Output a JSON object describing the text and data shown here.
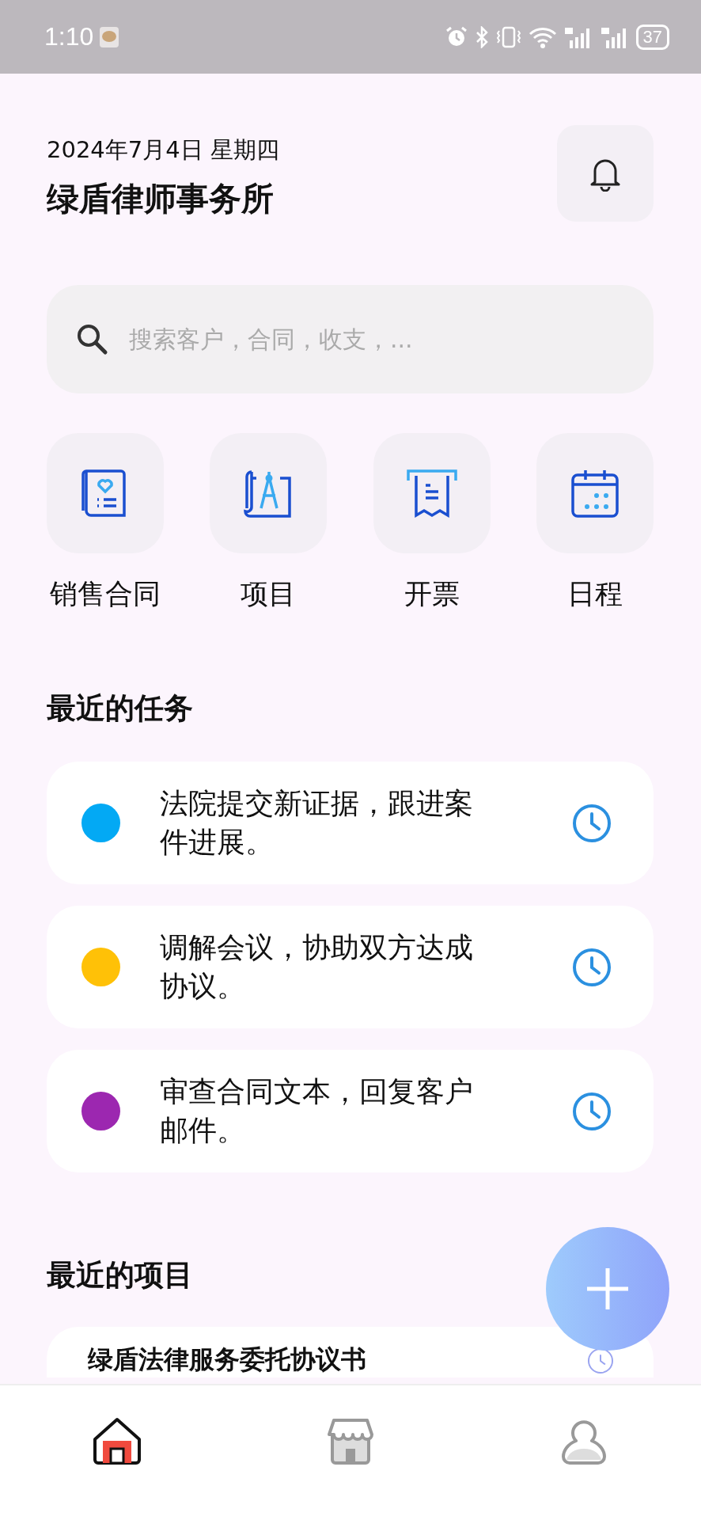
{
  "status_bar": {
    "time": "1:10",
    "battery": "37"
  },
  "header": {
    "date": "2024年7月4日 星期四",
    "title": "绿盾律师事务所"
  },
  "search": {
    "placeholder": "搜索客户，合同，收支，..."
  },
  "shortcuts": [
    {
      "label": "销售合同",
      "kind": "contract"
    },
    {
      "label": "项目",
      "kind": "project"
    },
    {
      "label": "开票",
      "kind": "invoice"
    },
    {
      "label": "日程",
      "kind": "calendar"
    }
  ],
  "tasks_section": {
    "title": "最近的任务"
  },
  "tasks": [
    {
      "text": "法院提交新证据，跟进案件进展。",
      "color": "#03a9f4"
    },
    {
      "text": "调解会议，协助双方达成协议。",
      "color": "#ffc107"
    },
    {
      "text": "审查合同文本，回复客户邮件。",
      "color": "#9c27b0"
    }
  ],
  "projects_section": {
    "title": "最近的项目"
  },
  "projects": [
    {
      "text": "绿盾法律服务委托协议书"
    }
  ],
  "bottom_nav": [
    {
      "kind": "home",
      "selected": true
    },
    {
      "kind": "store",
      "selected": false
    },
    {
      "kind": "profile",
      "selected": false
    }
  ]
}
